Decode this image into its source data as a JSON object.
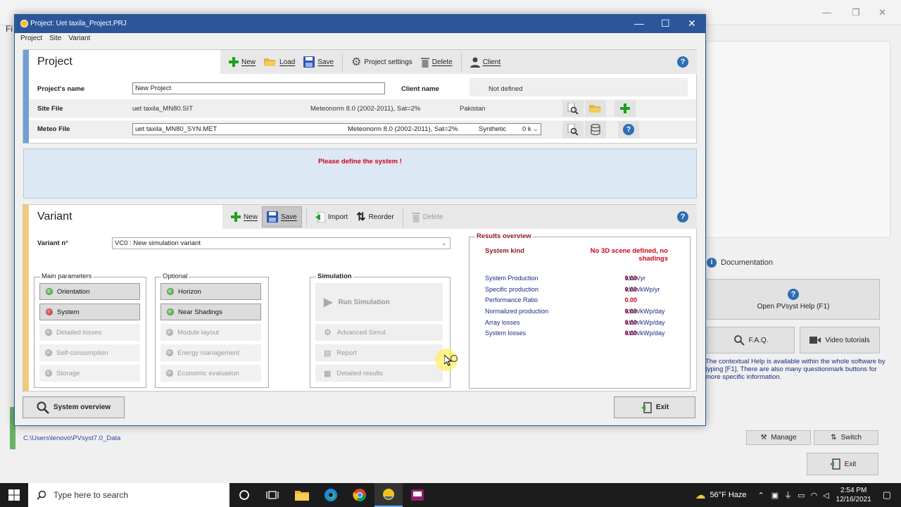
{
  "background": {
    "menu_first_letter": "Fi",
    "documentation_title": "Documentation",
    "help_button": "Open PVsyst Help (F1)",
    "faq_button": "F.A.Q.",
    "video_button": "Video tutorials",
    "help_text": "The contextual Help is available within the whole software by typing [F1]. There are also many questionmark buttons for more specific information.",
    "manage_button": "Manage",
    "switch_button": "Switch",
    "exit_button": "Exit",
    "data_path": "C:\\Users\\lenovo\\PVsyst7.0_Data"
  },
  "dialog": {
    "title": "Project:  Uet taxila_Project.PRJ",
    "menu": [
      "Project",
      "Site",
      "Variant"
    ]
  },
  "project": {
    "title": "Project",
    "toolbar": {
      "new": "New",
      "load": "Load",
      "save": "Save",
      "settings": "Project settings",
      "delete": "Delete",
      "client": "Client"
    },
    "name_label": "Project's name",
    "name_value": "New Project",
    "client_label": "Client name",
    "client_value": "Not defined",
    "site_label": "Site File",
    "site_file": "uet taxila_MN80.SIT",
    "site_source": "Meteonorm 8.0 (2002-2011), Sat=2%",
    "site_country": "Pakistan",
    "meteo_label": "Meteo File",
    "meteo_file": "uet taxila_MN80_SYN.MET",
    "meteo_source": "Meteonorm 8.0 (2002-2011), Sat=2%",
    "meteo_type": "Synthetic",
    "meteo_extra": "0 k"
  },
  "message": "Please define the system !",
  "variant": {
    "title": "Variant",
    "toolbar": {
      "new": "New",
      "save": "Save",
      "import": "Import",
      "reorder": "Reorder",
      "delete": "Delete"
    },
    "number_label": "Variant n°",
    "number_value": "VC0        : New simulation variant",
    "main_params_title": "Main parameters",
    "main_params": [
      {
        "label": "Orientation",
        "led": "green",
        "state": "active"
      },
      {
        "label": "System",
        "led": "red",
        "state": "active"
      },
      {
        "label": "Detailed losses",
        "led": "grey",
        "state": "inactive"
      },
      {
        "label": "Self-consumption",
        "led": "grey",
        "state": "inactive"
      },
      {
        "label": "Storage",
        "led": "grey",
        "state": "inactive"
      }
    ],
    "optional_title": "Optional",
    "optional": [
      {
        "label": "Horizon",
        "led": "green",
        "state": "active"
      },
      {
        "label": "Near Shadings",
        "led": "green",
        "state": "active"
      },
      {
        "label": "Module layout",
        "led": "grey",
        "state": "inactive"
      },
      {
        "label": "Energy management",
        "led": "grey",
        "state": "inactive"
      },
      {
        "label": "Economic evaluation",
        "led": "grey",
        "state": "inactive"
      }
    ],
    "simulation_title": "Simulation",
    "simulation": {
      "run": "Run Simulation",
      "advanced": "Advanced Simul.",
      "report": "Report",
      "detailed": "Detailed results"
    }
  },
  "results": {
    "title": "Results overview",
    "kind_label": "System kind",
    "kind_value": "No 3D scene defined, no shadings",
    "rows": [
      {
        "label": "System Production",
        "value": "0.00",
        "unit": "kWh/yr"
      },
      {
        "label": "Specific production",
        "value": "0.00",
        "unit": "kWh/kWp/yr"
      },
      {
        "label": "Performance Ratio",
        "value": "0.00",
        "unit": ""
      },
      {
        "label": "Normalized production",
        "value": "0.00",
        "unit": "kWh/kWp/day"
      },
      {
        "label": "Array losses",
        "value": "0.00",
        "unit": "kWh/kWp/day"
      },
      {
        "label": "System losses",
        "value": "0.00",
        "unit": "kWh/kWp/day"
      }
    ]
  },
  "footer": {
    "system_overview": "System overview",
    "exit": "Exit"
  },
  "taskbar": {
    "search_placeholder": "Type here to search",
    "weather": "56°F  Haze",
    "time": "2:54 PM",
    "date": "12/16/2021"
  },
  "colors": {
    "title_bar": "#2b579a",
    "project_accent": "#6f9fd4",
    "variant_accent": "#f4c87a",
    "error_red": "#d0021b",
    "message_bg": "#dce8f3"
  }
}
